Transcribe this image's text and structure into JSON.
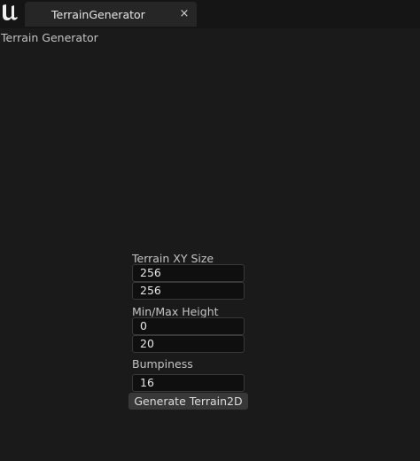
{
  "tab": {
    "title": "TerrainGenerator",
    "close_glyph": "×"
  },
  "window": {
    "title": "Terrain Generator"
  },
  "form": {
    "terrain_size": {
      "label": "Terrain XY Size",
      "x": "256",
      "y": "256"
    },
    "height": {
      "label": "Min/Max Height",
      "min": "0",
      "max": "20"
    },
    "bumpiness": {
      "label": "Bumpiness",
      "value": "16"
    },
    "generate_button": "Generate Terrain2D"
  },
  "icons": {
    "logo": "unreal-engine-logo-icon",
    "close": "close-icon"
  }
}
